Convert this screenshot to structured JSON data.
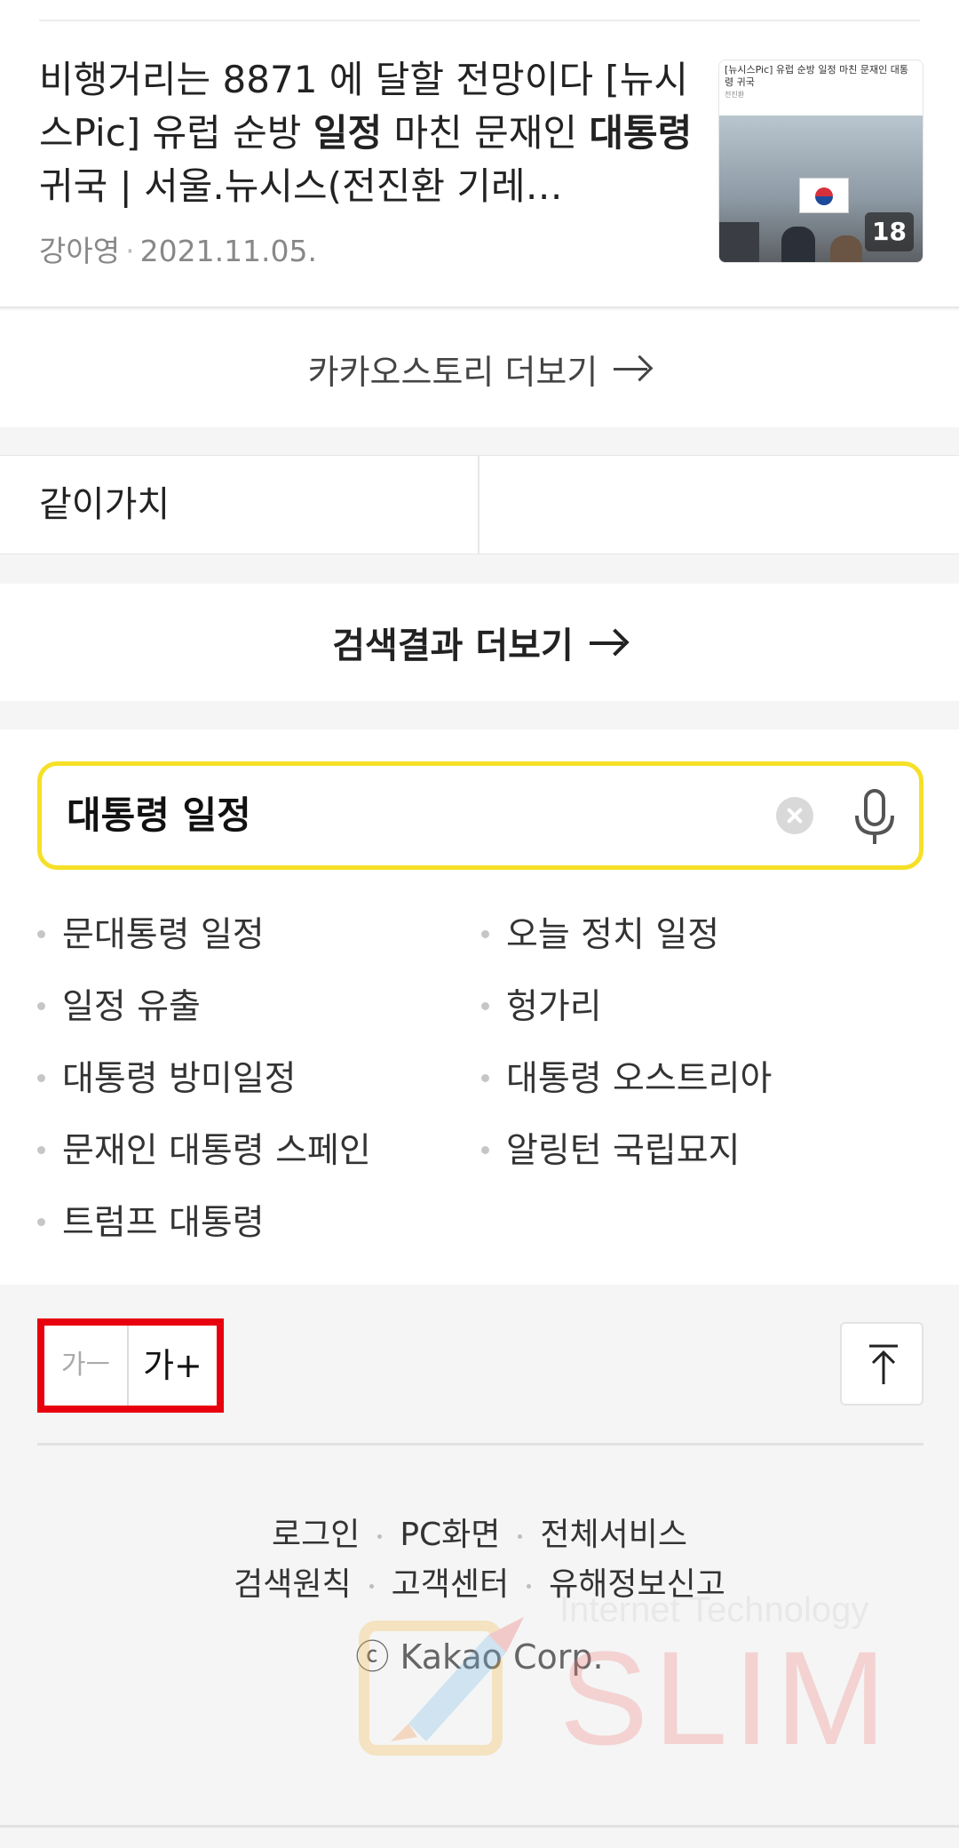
{
  "article": {
    "title_pre": "비행거리는 8871 에 달할 전망이다 [뉴시스Pic] 유럽 순방 ",
    "title_bold1": "일정",
    "title_mid": " 마친 문재인 ",
    "title_bold2": "대통령",
    "title_post": " 귀국 | 서울.뉴시스(전진환 기레…",
    "author": "강아영",
    "date": "2021.11.05.",
    "thumb_caption": "[뉴시스Pic] 유럽 순방 일정 마친 문재인 대통령 귀국",
    "thumb_byline": "전진환",
    "thumb_count": "18"
  },
  "more_story_label": "카카오스토리 더보기",
  "together_label": "같이가치",
  "more_results_label": "검색결과 더보기",
  "search": {
    "query": "대통령 일정"
  },
  "suggestions": {
    "left": [
      "문대통령 일정",
      "일정 유출",
      "대통령 방미일정",
      "문재인 대통령 스페인",
      "트럼프 대통령"
    ],
    "right": [
      "오늘 정치 일정",
      "헝가리",
      "대통령 오스트리아",
      "알링턴 국립묘지"
    ]
  },
  "font_control": {
    "decrease_label": "가ㅡ",
    "increase_label": "가+"
  },
  "footer": {
    "row1": [
      "로그인",
      "PC화면",
      "전체서비스"
    ],
    "row2": [
      "검색원칙",
      "고객센터",
      "유해정보신고"
    ],
    "copyright": "ⓒ Kakao Corp."
  },
  "watermark": {
    "line1": "Internet Technology",
    "line2": "SLIM"
  },
  "colors": {
    "search_border": "#f6e027",
    "highlight_box": "#e8000f"
  }
}
